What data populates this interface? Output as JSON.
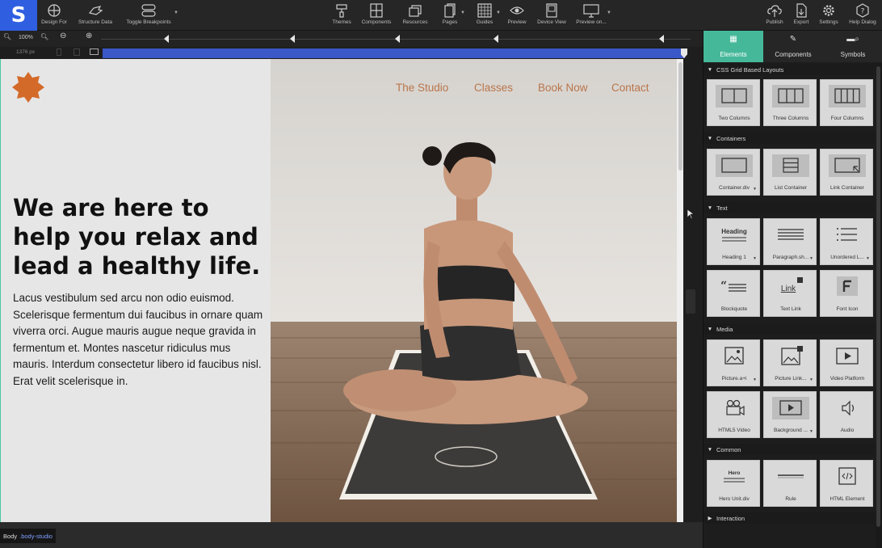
{
  "toolbar": {
    "logo": "S",
    "left_buttons": [
      {
        "label": "Design For",
        "icon": "crosshair-icon"
      },
      {
        "label": "Structure Data",
        "icon": "hand-icon"
      },
      {
        "label": "Toggle Breakpoints",
        "icon": "toggle-icon"
      }
    ],
    "center_buttons": [
      {
        "label": "Themes",
        "icon": "paint-roller-icon"
      },
      {
        "label": "Components",
        "icon": "grid-icon"
      },
      {
        "label": "Resources",
        "icon": "stack-icon"
      },
      {
        "label": "Pages",
        "icon": "pages-icon"
      },
      {
        "label": "Guides",
        "icon": "guides-icon"
      },
      {
        "label": "Preview",
        "icon": "eye-icon"
      },
      {
        "label": "Device View",
        "icon": "device-icon"
      },
      {
        "label": "Preview on...",
        "icon": "monitor-icon"
      }
    ],
    "right_buttons": [
      {
        "label": "Publish",
        "icon": "cloud-upload-icon"
      },
      {
        "label": "Export",
        "icon": "export-icon"
      },
      {
        "label": "Settings",
        "icon": "gear-icon"
      },
      {
        "label": "Help Dialog",
        "icon": "help-icon"
      }
    ]
  },
  "zoom": {
    "level": "100%"
  },
  "canvas_width": "1376 px",
  "site": {
    "nav": [
      "The Studio",
      "Classes",
      "Book Now",
      "Contact"
    ],
    "hero_title": "We are here to help you relax and lead a healthy life.",
    "hero_body": "Lacus vestibulum sed arcu non odio euismod. Scelerisque fermentum dui faucibus in ornare quam viverra orci. Augue mauris augue neque gravida in fermentum et. Montes nascetur ridiculus mus mauris. Interdum consectetur libero id faucibus nisl. Erat velit scelerisque in.",
    "accent": "#b9754a",
    "brand_color": "#d46a2a"
  },
  "statusbar": {
    "element": "Body",
    "class": ".body-studio"
  },
  "panel": {
    "tabs": [
      {
        "label": "Elements",
        "icon": "grid-icon",
        "active": true
      },
      {
        "label": "Components",
        "icon": "brush-icon",
        "active": false
      },
      {
        "label": "Symbols",
        "icon": "search-symbols-icon",
        "active": false
      }
    ],
    "sections": [
      {
        "title": "CSS Grid Based Layouts",
        "items": [
          "Two Columns",
          "Three Columns",
          "Four Columns"
        ]
      },
      {
        "title": "Containers",
        "items": [
          "Container.div",
          "List Container",
          "Link Container"
        ]
      },
      {
        "title": "Text",
        "items": [
          "Heading 1",
          "Paragraph.sh...",
          "Unordered L...",
          "Blockquote",
          "Text Link",
          "Font Icon"
        ]
      },
      {
        "title": "Media",
        "items": [
          "Picture.a+i",
          "Picture Link...",
          "Video Platform",
          "HTML5 Video",
          "Background ...",
          "Audio"
        ]
      },
      {
        "title": "Common",
        "items": [
          "Hero Unit.div",
          "Rule",
          "HTML Element"
        ]
      },
      {
        "title": "Interaction",
        "items": []
      }
    ],
    "tile_text": {
      "heading": "Heading",
      "link": "Link",
      "hero": "Hero"
    }
  }
}
